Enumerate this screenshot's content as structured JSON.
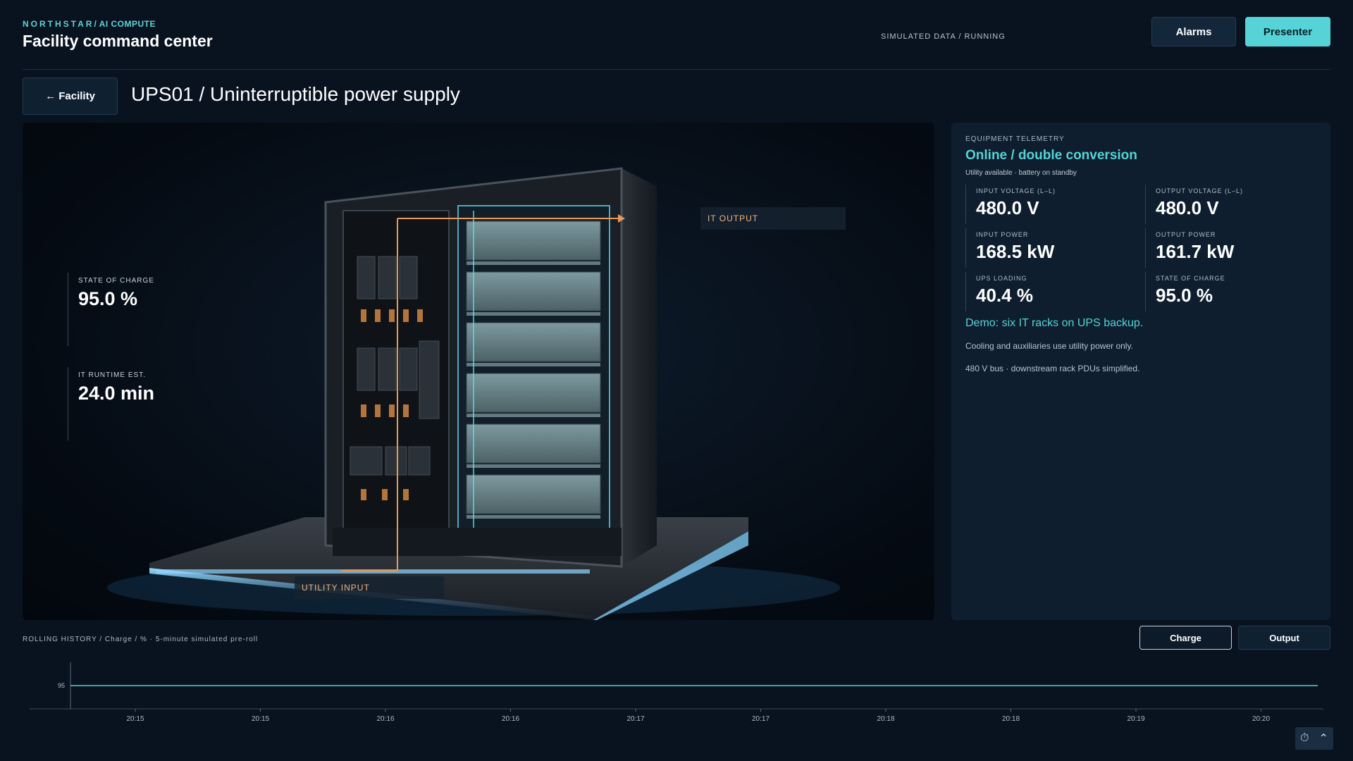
{
  "header": {
    "brand": "NORTHSTAR",
    "brand_sub": "/ AI COMPUTE",
    "title": "Facility command center",
    "status": "SIMULATED DATA / RUNNING",
    "buttons": {
      "alarms": "Alarms",
      "presenter": "Presenter"
    }
  },
  "nav": {
    "back_label": "← Facility",
    "page_title": "UPS01 / Uninterruptible power supply"
  },
  "viewer": {
    "stats": [
      {
        "label": "STATE OF CHARGE",
        "value": "95.0 %"
      },
      {
        "label": "IT RUNTIME EST.",
        "value": "24.0 min"
      }
    ],
    "callouts": {
      "it_output": "IT OUTPUT",
      "utility_input": "UTILITY INPUT"
    }
  },
  "telemetry": {
    "kicker": "EQUIPMENT TELEMETRY",
    "status": "Online / double conversion",
    "note": "Utility available · battery on standby",
    "metrics": [
      {
        "label": "INPUT VOLTAGE (L–L)",
        "value": "480.0 V"
      },
      {
        "label": "OUTPUT VOLTAGE (L–L)",
        "value": "480.0 V"
      },
      {
        "label": "INPUT POWER",
        "value": "168.5 kW"
      },
      {
        "label": "OUTPUT POWER",
        "value": "161.7 kW"
      },
      {
        "label": "UPS LOADING",
        "value": "40.4 %"
      },
      {
        "label": "STATE OF CHARGE",
        "value": "95.0 %"
      }
    ],
    "demo": "Demo: six IT racks on UPS backup.",
    "lines": [
      "Cooling and auxiliaries use utility power only.",
      "480 V bus · downstream rack PDUs simplified."
    ]
  },
  "history": {
    "label": "ROLLING HISTORY / Charge / % · 5-minute simulated pre-roll",
    "buttons": {
      "charge": "Charge",
      "output": "Output"
    }
  },
  "colors": {
    "accent": "#55d3d6",
    "callout": "#f2b67c",
    "background": "#09131f"
  },
  "icons": {
    "timer": "timer-icon",
    "collapse": "chevron-up-icon"
  },
  "chart_data": {
    "type": "line",
    "title": "",
    "xlabel": "",
    "ylabel": "",
    "x_ticks": [
      "20:15",
      "20:15",
      "20:16",
      "20:16",
      "20:17",
      "20:17",
      "20:18",
      "20:18",
      "20:19",
      "20:20"
    ],
    "y_ticks": [
      95
    ],
    "series": [
      {
        "values": [
          95,
          95,
          95,
          95,
          95,
          95,
          95,
          95,
          95,
          95,
          95
        ]
      }
    ]
  }
}
